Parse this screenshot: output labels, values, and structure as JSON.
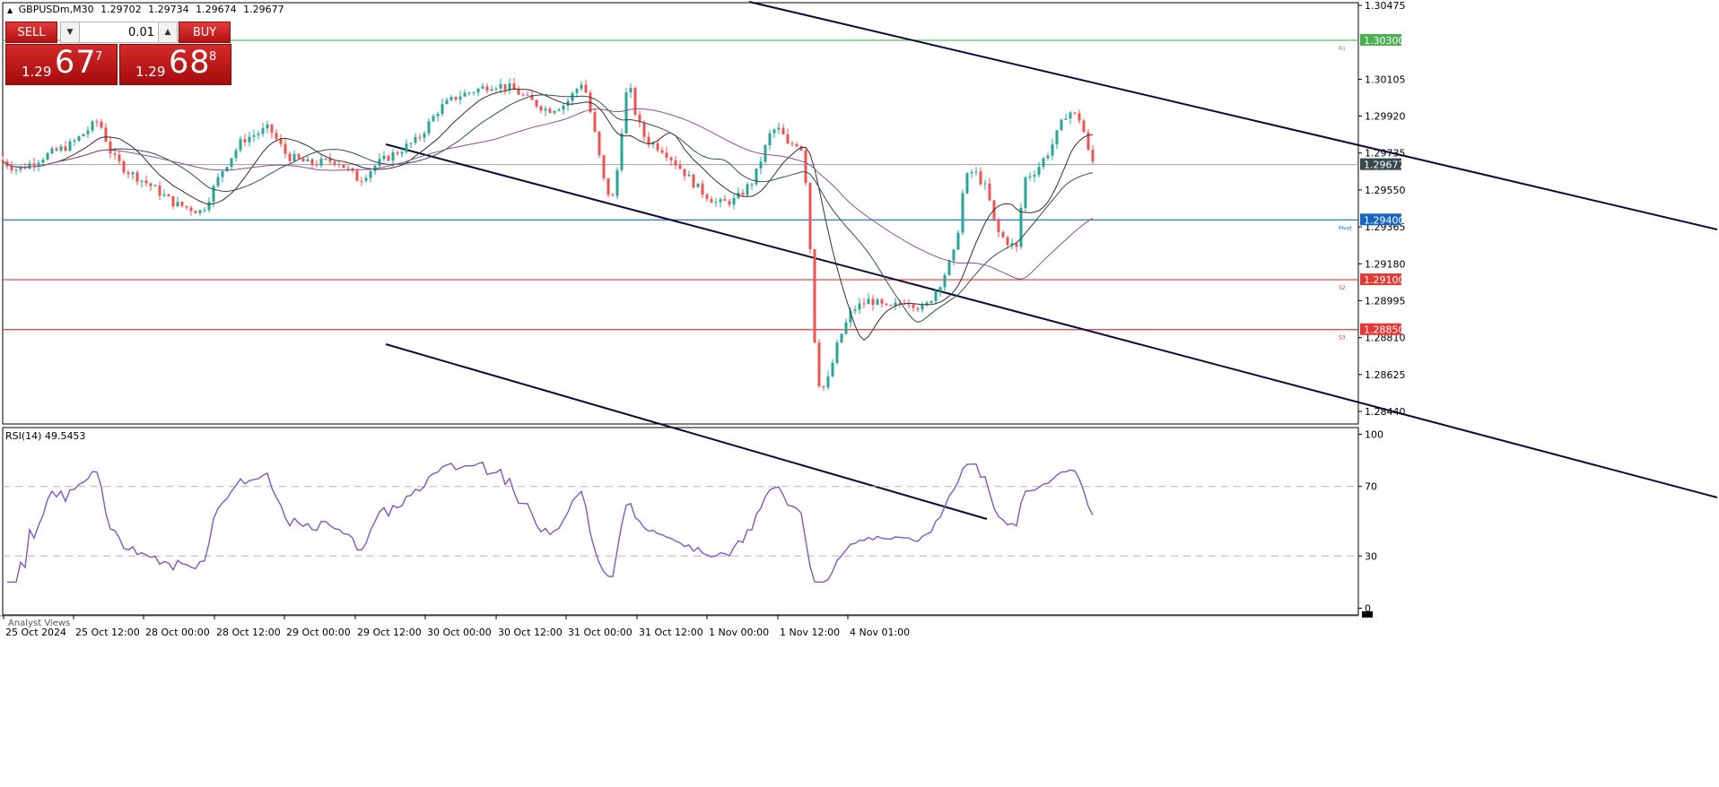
{
  "header": {
    "symbol": "GBPUSDm,M30",
    "open": "1.29702",
    "high": "1.29734",
    "low": "1.29674",
    "close": "1.29677"
  },
  "trade_panel": {
    "sell_label": "SELL",
    "buy_label": "BUY",
    "lot_value": "0.01",
    "sell_price_prefix": "1.29",
    "sell_price_big": "67",
    "sell_price_sup": "7",
    "buy_price_prefix": "1.29",
    "buy_price_big": "68",
    "buy_price_sup": "8"
  },
  "colors": {
    "bull": "#26a69a",
    "bear": "#ef5350",
    "resistance": "#4caf50",
    "pivot": "#1565c0",
    "support": "#e53935",
    "channel": "#0a0a3c",
    "rsi": "#7e57c2",
    "current": "#000000"
  },
  "chart_data": {
    "type": "candlestick",
    "axis": {
      "y_ticks": [
        "1.30475",
        "1.30105",
        "1.29920",
        "1.29735",
        "1.29550",
        "1.29365",
        "1.29180",
        "1.28995",
        "1.28810",
        "1.28625",
        "1.28440"
      ],
      "x_ticks": [
        "25 Oct 2024",
        "25 Oct 12:00",
        "28 Oct 00:00",
        "28 Oct 12:00",
        "29 Oct 00:00",
        "29 Oct 12:00",
        "30 Oct 00:00",
        "30 Oct 12:00",
        "31 Oct 00:00",
        "31 Oct 12:00",
        "1 Nov 00:00",
        "1 Nov 12:00",
        "4 Nov 01:00"
      ],
      "ylim": [
        1.2835,
        1.3057
      ]
    },
    "levels": [
      {
        "price": 1.303,
        "label": "1.30300",
        "tag": "R1",
        "kind": "resistance"
      },
      {
        "price": 1.294,
        "label": "1.29400",
        "tag": "Pivot",
        "kind": "pivot"
      },
      {
        "price": 1.291,
        "label": "1.29100",
        "tag": "S2",
        "kind": "support"
      },
      {
        "price": 1.2885,
        "label": "1.28850",
        "tag": "S3",
        "kind": "support"
      }
    ],
    "current_price": {
      "price": 1.29677,
      "label": "1.29677"
    },
    "rsi": {
      "label": "RSI(14) 49.5453",
      "levels": [
        70,
        30
      ],
      "y_ticks": [
        "100",
        "70",
        "30",
        "0"
      ],
      "ylim": [
        0,
        100
      ]
    },
    "footer_label": "Analyst Views"
  }
}
